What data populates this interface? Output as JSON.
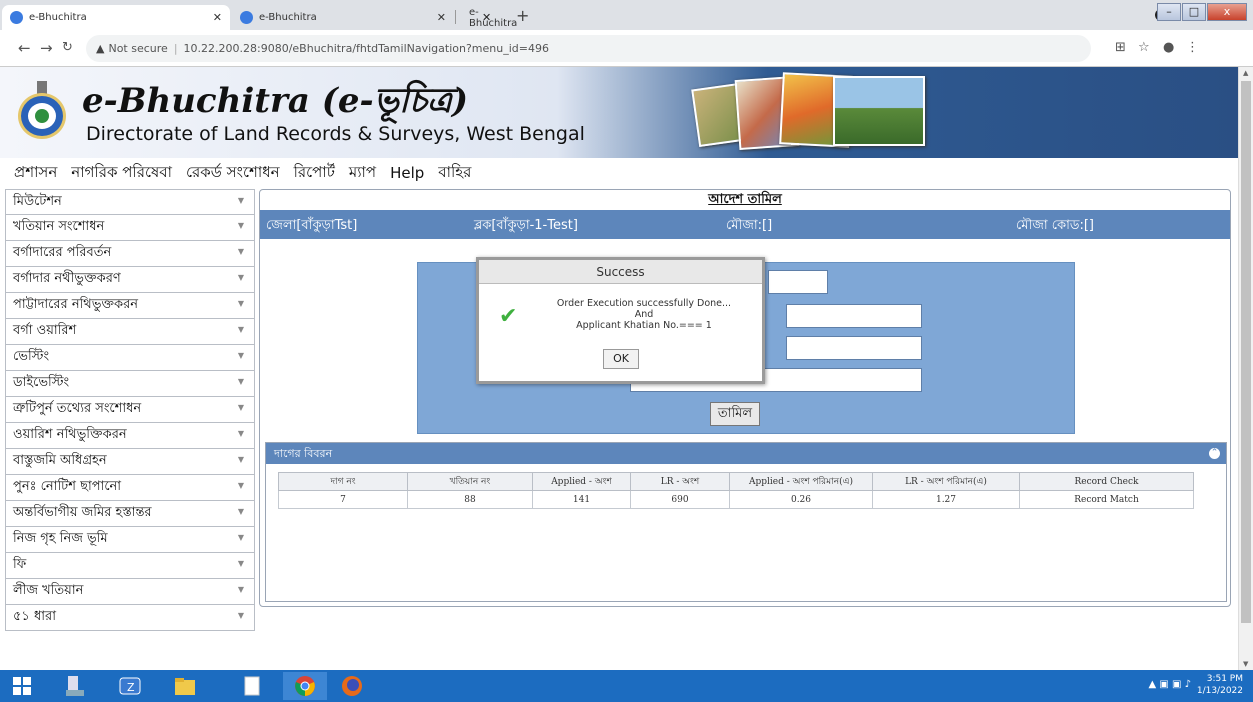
{
  "browser": {
    "tabs": [
      {
        "title": "e-Bhuchitra"
      },
      {
        "title": "e-Bhuchitra"
      },
      {
        "title": "e-Bhuchitra"
      }
    ],
    "new_tab": "+",
    "security_label": "Not secure",
    "url": "10.22.200.28:9080/eBhuchitra/fhtdTamilNavigation?menu_id=496",
    "win_buttons": {
      "minimize": "–",
      "maximize": "□",
      "close": "x"
    }
  },
  "header": {
    "title_main": "e-Bhuchitra (e-ভূচিত্র)",
    "subtitle": "Directorate of Land Records & Surveys, West Bengal"
  },
  "menu": [
    "প্রশাসন",
    "নাগরিক পরিষেবা",
    "রেকর্ড সংশোধন",
    "রিপোর্ট",
    "ম্যাপ",
    "Help",
    "বাহির"
  ],
  "sidebar": {
    "items": [
      "মিউটেশন",
      "খতিয়ান সংশোধন",
      "বর্গাদারের পরিবর্তন",
      "বর্গাদার নথীভুক্তকরণ",
      "পাট্টাদারের নথিভুক্তকরন",
      "বর্গা ওয়ারিশ",
      "ভেস্টিং",
      "ডাইভেস্টিং",
      "ত্রুটিপুর্ন তথ্যের সংশোধন",
      "ওয়ারিশ নথিভুক্তিকরন",
      "বাস্তুজমি অধিগ্রহন",
      "পুনঃ নোটিশ ছাপানো",
      "অন্তর্বিভাগীয় জমির হস্তান্তর",
      "নিজ গৃহ নিজ ভূমি",
      "ফি",
      "লীজ খতিয়ান",
      "৫১ ধারা"
    ]
  },
  "main": {
    "heading": "আদেশ তামিল",
    "info": {
      "district": "জেলা[বাঁকুড়াTst]",
      "block": "ব্লক[বাঁকুড়া-1-Test]",
      "mouza": "মৌজা:[]",
      "mouza_code": "মৌজা কোড:[]"
    },
    "submit_label": "তামিল",
    "grid": {
      "title": "দাগের বিবরন",
      "columns": [
        "দাগ নং",
        "খতিয়ান নং",
        "Applied - অংশ",
        "LR - অংশ",
        "Applied - অংশ পরিমান(এ)",
        "LR - অংশ পরিমান(এ)",
        "Record Check"
      ],
      "rows": [
        [
          "7",
          "88",
          "141",
          "690",
          "0.26",
          "1.27",
          "Record Match"
        ]
      ]
    }
  },
  "dialog": {
    "title": "Success",
    "line1": "Order Execution successfully Done...",
    "line2": "And",
    "line3": "Applicant Khatian No.=== 1",
    "ok_label": "OK"
  },
  "taskbar": {
    "time": "3:51 PM",
    "date": "1/13/2022"
  }
}
